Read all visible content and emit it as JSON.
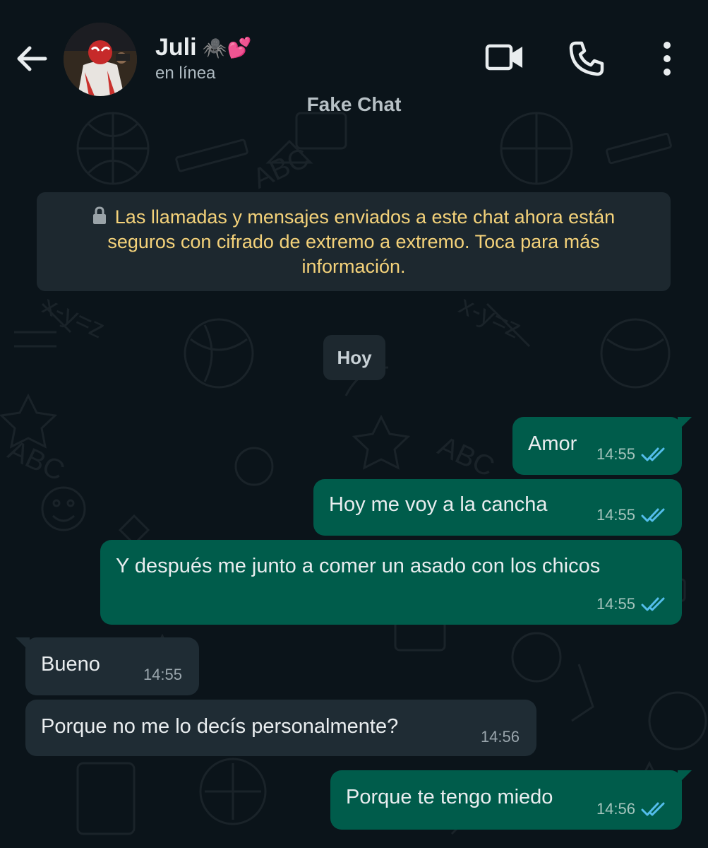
{
  "header": {
    "contact_name": "Juli",
    "contact_emojis": "🕷️💕",
    "status": "en línea",
    "icons": [
      "back-arrow-icon",
      "video-call-icon",
      "phone-icon",
      "more-options-icon"
    ]
  },
  "overlay_label": "Fake Chat",
  "encryption_notice": "Las llamadas y mensajes enviados a este chat ahora están seguros con cifrado de extremo a extremo. Toca para más información.",
  "day_chip": "Hoy",
  "messages": [
    {
      "direction": "out",
      "text": "Amor",
      "time": "14:55",
      "status": "read"
    },
    {
      "direction": "out",
      "text": "Hoy me voy a la cancha",
      "time": "14:55",
      "status": "read"
    },
    {
      "direction": "out",
      "text": "Y después me junto a comer un asado con los chicos",
      "time": "14:55",
      "status": "read"
    },
    {
      "direction": "in",
      "text": "Bueno",
      "time": "14:55"
    },
    {
      "direction": "in",
      "text": "Porque no me lo decís personalmente?",
      "time": "14:56"
    },
    {
      "direction": "out",
      "text": "Porque te tengo miedo",
      "time": "14:56",
      "status": "read"
    }
  ],
  "colors": {
    "background": "#0b141a",
    "outgoing_bubble": "#005c4b",
    "incoming_bubble": "#1f2c34",
    "notice_text": "#f4d27a",
    "read_tick": "#53bdeb"
  }
}
